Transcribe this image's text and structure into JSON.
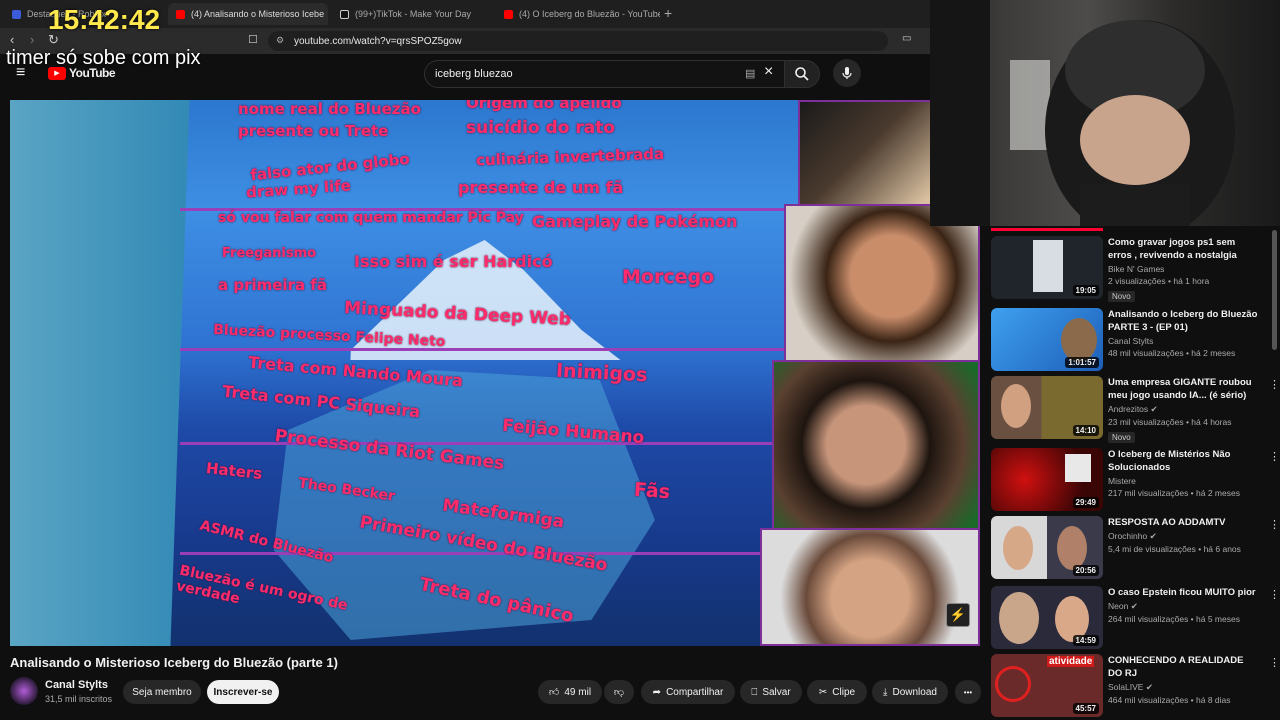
{
  "browser": {
    "tabs": [
      {
        "label": "Destaques - Roblox",
        "color": "#3b5bdb"
      },
      {
        "label": "(4) Analisando o Misterioso Icebe",
        "color": "#ff0000"
      },
      {
        "label": "(99+)TikTok - Make Your Day",
        "color": "#111111"
      },
      {
        "label": "(4) O Iceberg do Bluezão - YouTube",
        "color": "#ff0000"
      }
    ],
    "url": "youtube.com/watch?v=qrsSPOZ5gow",
    "new_tab": "+",
    "close": "×"
  },
  "overlay": {
    "timer": "15:42:42",
    "text": "timer só sobe com pix"
  },
  "youtube": {
    "logo": "YouTube",
    "search_value": "iceberg bluezao",
    "clear": "×"
  },
  "video": {
    "iceberg_labels": [
      "nome real do Bluezão",
      "Origem do apelido",
      "presente ou Trete",
      "suicídio do rato",
      "falso ator do globo",
      "culinária invertebrada",
      "draw my life",
      "presente de um fã",
      "só vou falar com quem mandar Pic Pay",
      "Gameplay de Pokémon",
      "Freeganismo",
      "Isso sim é ser Hardicó",
      "a primeira fã",
      "Morcego",
      "Minguado da Deep Web",
      "Bluezão processo Felipe Neto",
      "Treta com Nando Moura",
      "Inimigos",
      "Treta com PC Siqueira",
      "Feijão Humano",
      "Processo da Riot Games",
      "Haters",
      "Theo Becker",
      "Fãs",
      "Mateformiga",
      "Primeiro vídeo do Bluezão",
      "ASMR do Bluezão",
      "Bluezão é um ogro de verdade",
      "Treta do pânico"
    ],
    "title": "Analisando o Misterioso Iceberg do Bluezão (parte 1)",
    "channel": "Canal Stylts",
    "subscribers": "31,5 mil inscritos",
    "join": "Seja membro",
    "subscribe": "Inscrever-se",
    "likes": "49 mil",
    "share": "Compartilhar",
    "save": "Salvar",
    "clip": "Clipe",
    "download": "Download",
    "more": "•••"
  },
  "sidebar": [
    {
      "title": "Como gravar jogos ps1 sem erros , revivendo a nostalgia",
      "channel": "Bike N' Games",
      "verified": false,
      "meta": "2 visualizações • há 1 hora",
      "badge": "Novo",
      "duration": "19:05",
      "bg": "#20252b"
    },
    {
      "title": "Analisando o Iceberg do Bluezão PARTE 3 - (EP 01)",
      "channel": "Canal Stylts",
      "verified": false,
      "meta": "48 mil visualizações • há 2 meses",
      "badge": "",
      "duration": "1:01:57",
      "bg": "#1f7fd6"
    },
    {
      "title": "Uma empresa GIGANTE roubou meu jogo usando IA... (é sério)",
      "channel": "Andrezitos",
      "verified": true,
      "meta": "23 mil visualizações • há 4 horas",
      "badge": "Novo",
      "duration": "14:10",
      "bg": "#7a5a36"
    },
    {
      "title": "O Iceberg de Mistérios Não Solucionados",
      "channel": "Mistere",
      "verified": false,
      "meta": "217 mil visualizações • há 2 meses",
      "badge": "",
      "duration": "29:49",
      "bg": "#5a0c0c"
    },
    {
      "title": "RESPOSTA AO ADDAMTV",
      "channel": "Orochinho",
      "verified": true,
      "meta": "5,4 mi de visualizações • há 6 anos",
      "badge": "",
      "duration": "20:56",
      "bg": "#4a3a36"
    },
    {
      "title": "O caso Epstein ficou MUITO pior",
      "channel": "Neon",
      "verified": true,
      "meta": "264 mil visualizações • há 5 meses",
      "badge": "",
      "duration": "14:59",
      "bg": "#2a2a3a"
    },
    {
      "title": "CONHECENDO A REALIDADE DO RJ",
      "channel": "SolaLIVE",
      "verified": true,
      "meta": "464 mil visualizações • há 8 dias",
      "badge": "",
      "duration": "45:57",
      "bg": "#6a2a2a",
      "thumb_text": "atividade"
    }
  ],
  "colors": {
    "bg": "#0f0f0f",
    "label": "#ff2b6a",
    "accent": "#ff0000",
    "timer": "#ffe94d"
  }
}
